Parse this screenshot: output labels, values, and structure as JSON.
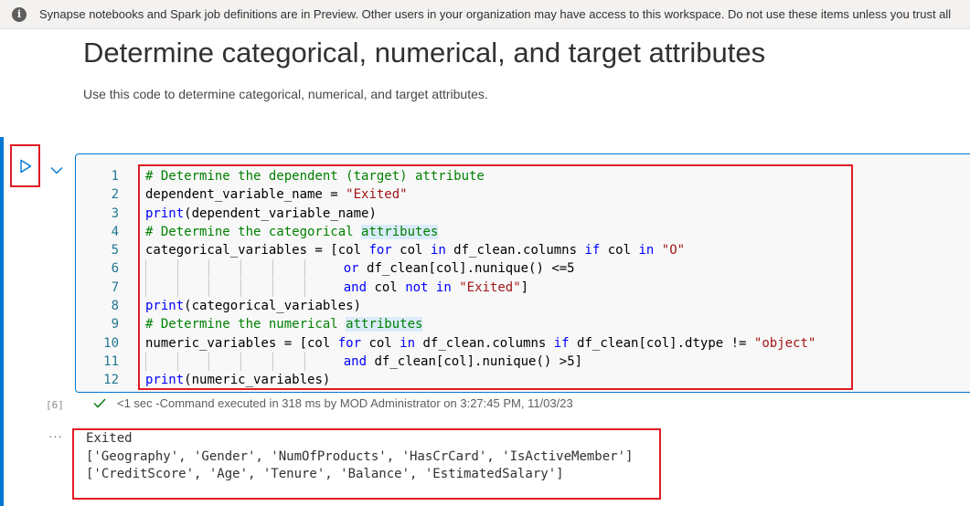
{
  "banner": {
    "icon": "info-icon",
    "message": "Synapse notebooks and Spark job definitions are in Preview. Other users in your organization may have access to this workspace. Do not use these items unless you trust all"
  },
  "markdown_cell": {
    "title": "Determine categorical, numerical, and target attributes",
    "description": "Use this code to determine categorical, numerical, and target attributes."
  },
  "code_cell": {
    "run_icon": "run-icon",
    "collapse_icon": "chevron-down-icon",
    "execution_count": "[6]",
    "status_text": "<1 sec -Command executed in 318 ms by MOD Administrator on 3:27:45 PM, 11/03/23",
    "lines": [
      {
        "n": "1",
        "tokens": [
          [
            "cm",
            "# Determine the dependent (target) attribute"
          ]
        ]
      },
      {
        "n": "2",
        "tokens": [
          [
            "",
            "dependent_variable_name = "
          ],
          [
            "str",
            "\"Exited\""
          ]
        ]
      },
      {
        "n": "3",
        "tokens": [
          [
            "kw",
            "print"
          ],
          [
            "",
            "(dependent_variable_name)"
          ]
        ]
      },
      {
        "n": "4",
        "tokens": [
          [
            "cm",
            "# Determine the categorical "
          ],
          [
            "cm hl",
            "attributes"
          ]
        ]
      },
      {
        "n": "5",
        "tokens": [
          [
            "",
            "categorical_variables = [col "
          ],
          [
            "kw",
            "for"
          ],
          [
            "",
            " col "
          ],
          [
            "kw",
            "in"
          ],
          [
            "",
            " df_clean.columns "
          ],
          [
            "kw",
            "if"
          ],
          [
            "",
            " col "
          ],
          [
            "kw",
            "in"
          ],
          [
            "",
            " "
          ],
          [
            "str",
            "\"O\""
          ]
        ]
      },
      {
        "n": "6",
        "tokens": [
          [
            "guides",
            ""
          ],
          [
            "kw",
            "or"
          ],
          [
            "",
            " df_clean[col].nunique() <=5"
          ]
        ]
      },
      {
        "n": "7",
        "tokens": [
          [
            "guides",
            ""
          ],
          [
            "kw",
            "and"
          ],
          [
            "",
            " col "
          ],
          [
            "kw",
            "not in"
          ],
          [
            "",
            " "
          ],
          [
            "str",
            "\"Exited\""
          ],
          [
            "",
            "]"
          ]
        ]
      },
      {
        "n": "8",
        "tokens": [
          [
            "kw",
            "print"
          ],
          [
            "",
            "(categorical_variables)"
          ]
        ]
      },
      {
        "n": "9",
        "tokens": [
          [
            "cm",
            "# Determine the numerical "
          ],
          [
            "cm hl",
            "attributes"
          ]
        ]
      },
      {
        "n": "10",
        "tokens": [
          [
            "",
            "numeric_variables = [col "
          ],
          [
            "kw",
            "for"
          ],
          [
            "",
            " col "
          ],
          [
            "kw",
            "in"
          ],
          [
            "",
            " df_clean.columns "
          ],
          [
            "kw",
            "if"
          ],
          [
            "",
            " df_clean[col].dtype != "
          ],
          [
            "str",
            "\"object\""
          ]
        ]
      },
      {
        "n": "11",
        "tokens": [
          [
            "guides",
            ""
          ],
          [
            "kw",
            "and"
          ],
          [
            "",
            " df_clean[col].nunique() >5]"
          ]
        ]
      },
      {
        "n": "12",
        "tokens": [
          [
            "kw",
            "print"
          ],
          [
            "",
            "(numeric_variables)"
          ]
        ]
      }
    ]
  },
  "output": {
    "ellipsis": "···",
    "lines": [
      "Exited",
      "['Geography', 'Gender', 'NumOfProducts', 'HasCrCard', 'IsActiveMember']",
      "['CreditScore', 'Age', 'Tenure', 'Balance', 'EstimatedSalary']"
    ]
  },
  "colors": {
    "accent": "#0078d4",
    "highlight_box": "#e01b24",
    "success": "#107c10"
  }
}
